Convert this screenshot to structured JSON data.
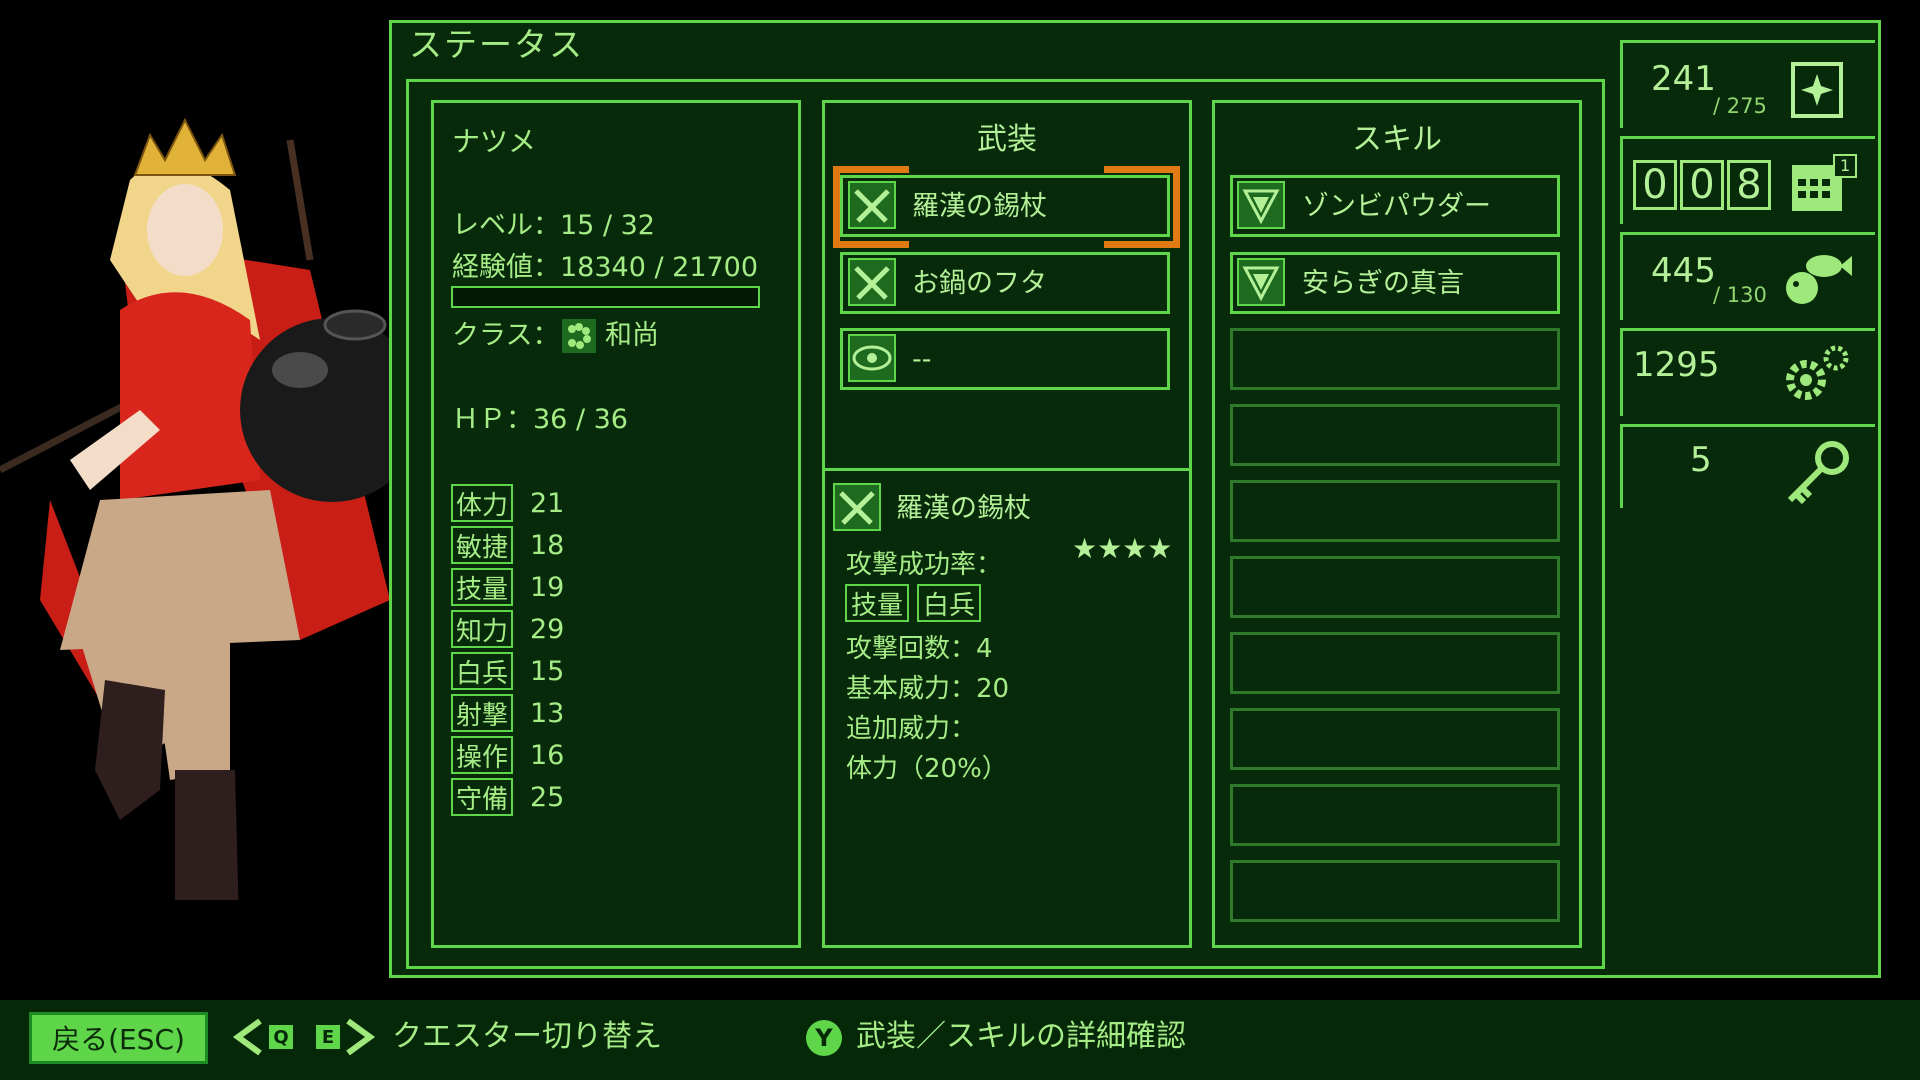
{
  "screen_title": "ステータス",
  "character": {
    "name": "ナツメ",
    "level_label": "レベル：15 / 32",
    "exp_label": "経験値：18340 / 21700",
    "exp_fraction": 0.0,
    "class_prefix": "クラス：",
    "class_name": "和尚",
    "hp_label": "ＨＰ：36 / 36",
    "stats": [
      {
        "label": "体力",
        "value": "21"
      },
      {
        "label": "敏捷",
        "value": "18"
      },
      {
        "label": "技量",
        "value": "19"
      },
      {
        "label": "知力",
        "value": "29"
      },
      {
        "label": "白兵",
        "value": "15"
      },
      {
        "label": "射撃",
        "value": "13"
      },
      {
        "label": "操作",
        "value": "16"
      },
      {
        "label": "守備",
        "value": "25"
      }
    ]
  },
  "equipment": {
    "heading": "武装",
    "slots": [
      {
        "label": "羅漢の錫杖",
        "icon": "crossed-weapons-icon",
        "selected": true
      },
      {
        "label": "お鍋のフタ",
        "icon": "crossed-weapons-icon",
        "selected": false
      },
      {
        "label": "--",
        "icon": "eye-shield-icon",
        "selected": false
      }
    ]
  },
  "detail": {
    "name": "羅漢の錫杖",
    "icon": "crossed-weapons-icon",
    "rating": "★★★★",
    "hit_rate_label": "攻撃成功率：",
    "hit_tags": [
      "技量",
      "白兵"
    ],
    "attacks_label": "攻撃回数：4",
    "base_power_label": "基本威力：20",
    "extra_power_label": "追加威力：",
    "extra_power_value": "体力（20%）"
  },
  "skills": {
    "heading": "スキル",
    "slots": [
      {
        "label": "ゾンビパウダー",
        "icon": "skill-triangle-icon"
      },
      {
        "label": "安らぎの真言",
        "icon": "skill-triangle-icon"
      }
    ],
    "empty_slot_count": 8
  },
  "resources": {
    "energy": {
      "value": "241",
      "max": "/ 275",
      "icon": "sparkle-card-icon"
    },
    "day_counter": {
      "digits": [
        "0",
        "0",
        "8"
      ],
      "badge": "1",
      "icon": "calendar-icon"
    },
    "food": {
      "value": "445",
      "max": "/ 130",
      "icon": "fish-food-icon"
    },
    "parts": {
      "value": "1295",
      "icon": "gears-icon"
    },
    "keys": {
      "value": "5",
      "icon": "key-icon"
    }
  },
  "bottom_bar": {
    "back_label": "戻る(ESC)",
    "key_q": "Q",
    "key_e": "E",
    "switch_label": "クエスター切り替え",
    "key_y": "Y",
    "detail_label": "武装／スキルの詳細確認"
  },
  "colors": {
    "accent": "#5fd64a",
    "panel_bg": "#062a0a",
    "selection": "#e07a12",
    "text": "#a6ec86"
  }
}
